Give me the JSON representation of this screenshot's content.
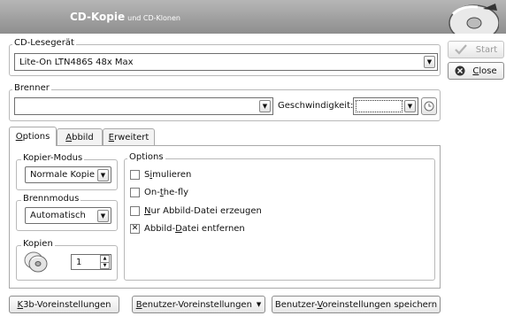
{
  "header": {
    "title": "CD-Kopie",
    "subtitle": "und CD-Klonen"
  },
  "reader": {
    "legend": "CD-Lesegerät",
    "selected": "Lite-On LTN486S 48x Max"
  },
  "burner": {
    "legend": "Brenner",
    "selected": "",
    "speed_label": "Geschwindigkeit:",
    "speed_value": ""
  },
  "actions": {
    "start": "Start",
    "close": "Close"
  },
  "tabs": [
    {
      "label": "Options",
      "active": true
    },
    {
      "label": "Abbild",
      "active": false
    },
    {
      "label": "Erweitert",
      "active": false
    }
  ],
  "copy_mode": {
    "legend": "Kopier-Modus",
    "selected": "Normale Kopie"
  },
  "write_mode": {
    "legend": "Brennmodus",
    "selected": "Automatisch"
  },
  "copies": {
    "legend": "Kopien",
    "value": "1"
  },
  "options": {
    "legend": "Options",
    "items": [
      {
        "label": "Simulieren",
        "checked": false
      },
      {
        "label": "On-the-fly",
        "checked": false
      },
      {
        "label": "Nur Abbild-Datei erzeugen",
        "checked": false
      },
      {
        "label": "Abbild-Datei entfernen",
        "checked": true
      }
    ]
  },
  "footer": {
    "k3b_defaults": "K3b-Voreinstellungen",
    "user_defaults": "Benutzer-Voreinstellungen",
    "save_user_defaults": "Benutzer-Voreinstellungen speichern"
  }
}
